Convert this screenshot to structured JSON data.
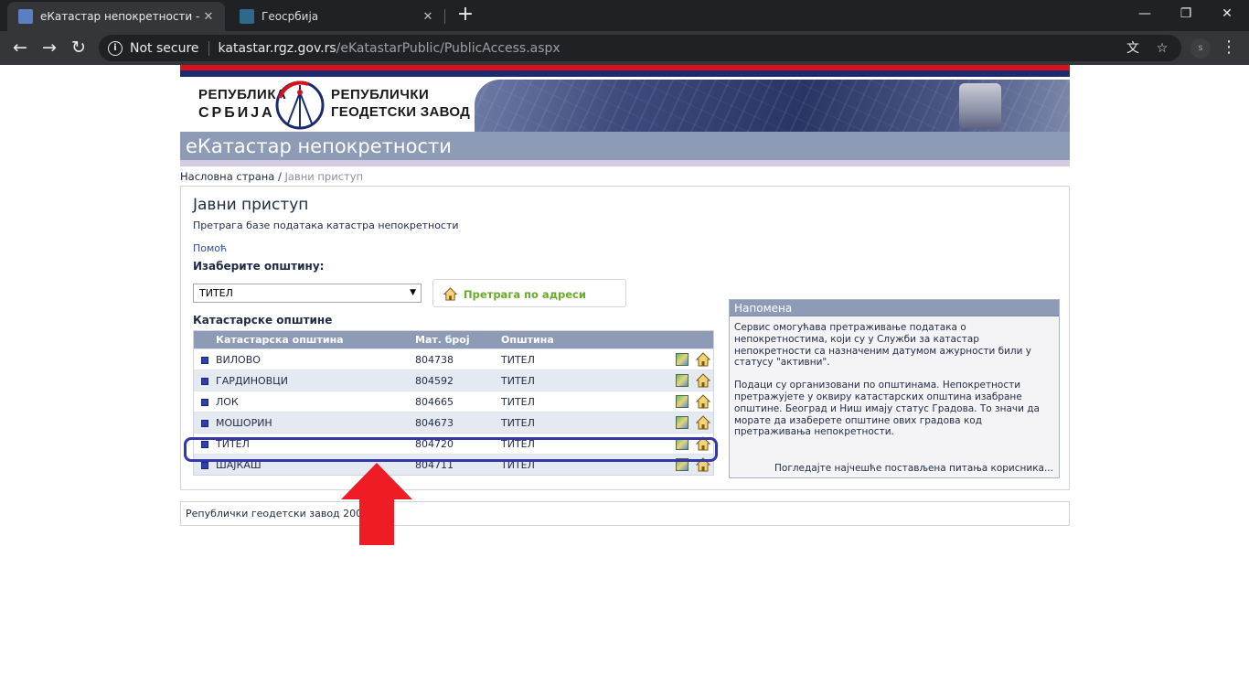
{
  "browser": {
    "tabs": [
      {
        "title": "еКатастар непокретности - јавни приступ",
        "close": "✕"
      },
      {
        "title": "Геосрбија",
        "close": "✕"
      }
    ],
    "new_tab": "+",
    "window_controls": {
      "minimize": "—",
      "restore": "❐",
      "close": "✕"
    },
    "nav": {
      "back": "←",
      "forward": "→",
      "reload": "↻"
    },
    "address": {
      "security_label": "Not secure",
      "host": "katastar.rgz.gov.rs",
      "path": "/eKatastarPublic/PublicAccess.aspx"
    },
    "translate_icon": "文",
    "bookmark_icon": "☆",
    "profile_initial": "s",
    "menu": "⋮"
  },
  "site": {
    "logo_left": {
      "line1": "РЕПУБЛИКА",
      "line2": "СРБИЈА"
    },
    "logo_right": {
      "line1": "РЕПУБЛИЧКИ",
      "line2": "ГЕОДЕТСКИ ЗАВОД"
    },
    "title": "еКатастар непокретности",
    "colors": {
      "red": "#d8111a",
      "navy": "#1c2b6e",
      "header_blue": "#8e9bb6",
      "link_green": "#6aaa2a"
    }
  },
  "breadcrumb": {
    "home": "Насловна страна",
    "separator": " / ",
    "current": "Јавни приступ"
  },
  "main": {
    "heading": "Јавни приступ",
    "subheading": "Претрага базе података катастра непокретности",
    "help_link": "Помоћ",
    "choose_label": "Изаберите општину:",
    "municipality_select": {
      "value": "ТИТЕЛ",
      "arrow": "▼"
    },
    "address_search_button": "Претрага по адреси",
    "cadastral_title": "Катастарске општине",
    "table": {
      "headers": [
        "Катастарска општина",
        "Мат. број",
        "Општина"
      ],
      "rows": [
        {
          "name": "ВИЛОВО",
          "mat": "804738",
          "municipality": "ТИТЕЛ"
        },
        {
          "name": "ГАРДИНОВЦИ",
          "mat": "804592",
          "municipality": "ТИТЕЛ"
        },
        {
          "name": "ЛОК",
          "mat": "804665",
          "municipality": "ТИТЕЛ"
        },
        {
          "name": "МОШОРИН",
          "mat": "804673",
          "municipality": "ТИТЕЛ"
        },
        {
          "name": "ТИТЕЛ",
          "mat": "804720",
          "municipality": "ТИТЕЛ"
        },
        {
          "name": "ШАЈКАШ",
          "mat": "804711",
          "municipality": "ТИТЕЛ"
        }
      ]
    }
  },
  "note": {
    "title": "Напомена",
    "paragraph1": "Сервис омогућава претраживање података о непокретностима, који су у Служби за катастар непокретности са назначеним датумом ажурности били у статусу \"активни\".",
    "paragraph2": "Подаци су организовани по општинама. Непокретности претражујете у оквиру катастарских општина изабране општине. Београд и Ниш имају статус Градова. То значи да морате да изаберете општине ових градова код претраживања непокретности.",
    "faq_link": "Погледајте најчешће постављена питања корисника..."
  },
  "footer": {
    "text": "Републички геодетски завод 2008"
  },
  "annotation": {
    "highlight_color": "#3437a6",
    "arrow_color": "#ee1c25"
  }
}
